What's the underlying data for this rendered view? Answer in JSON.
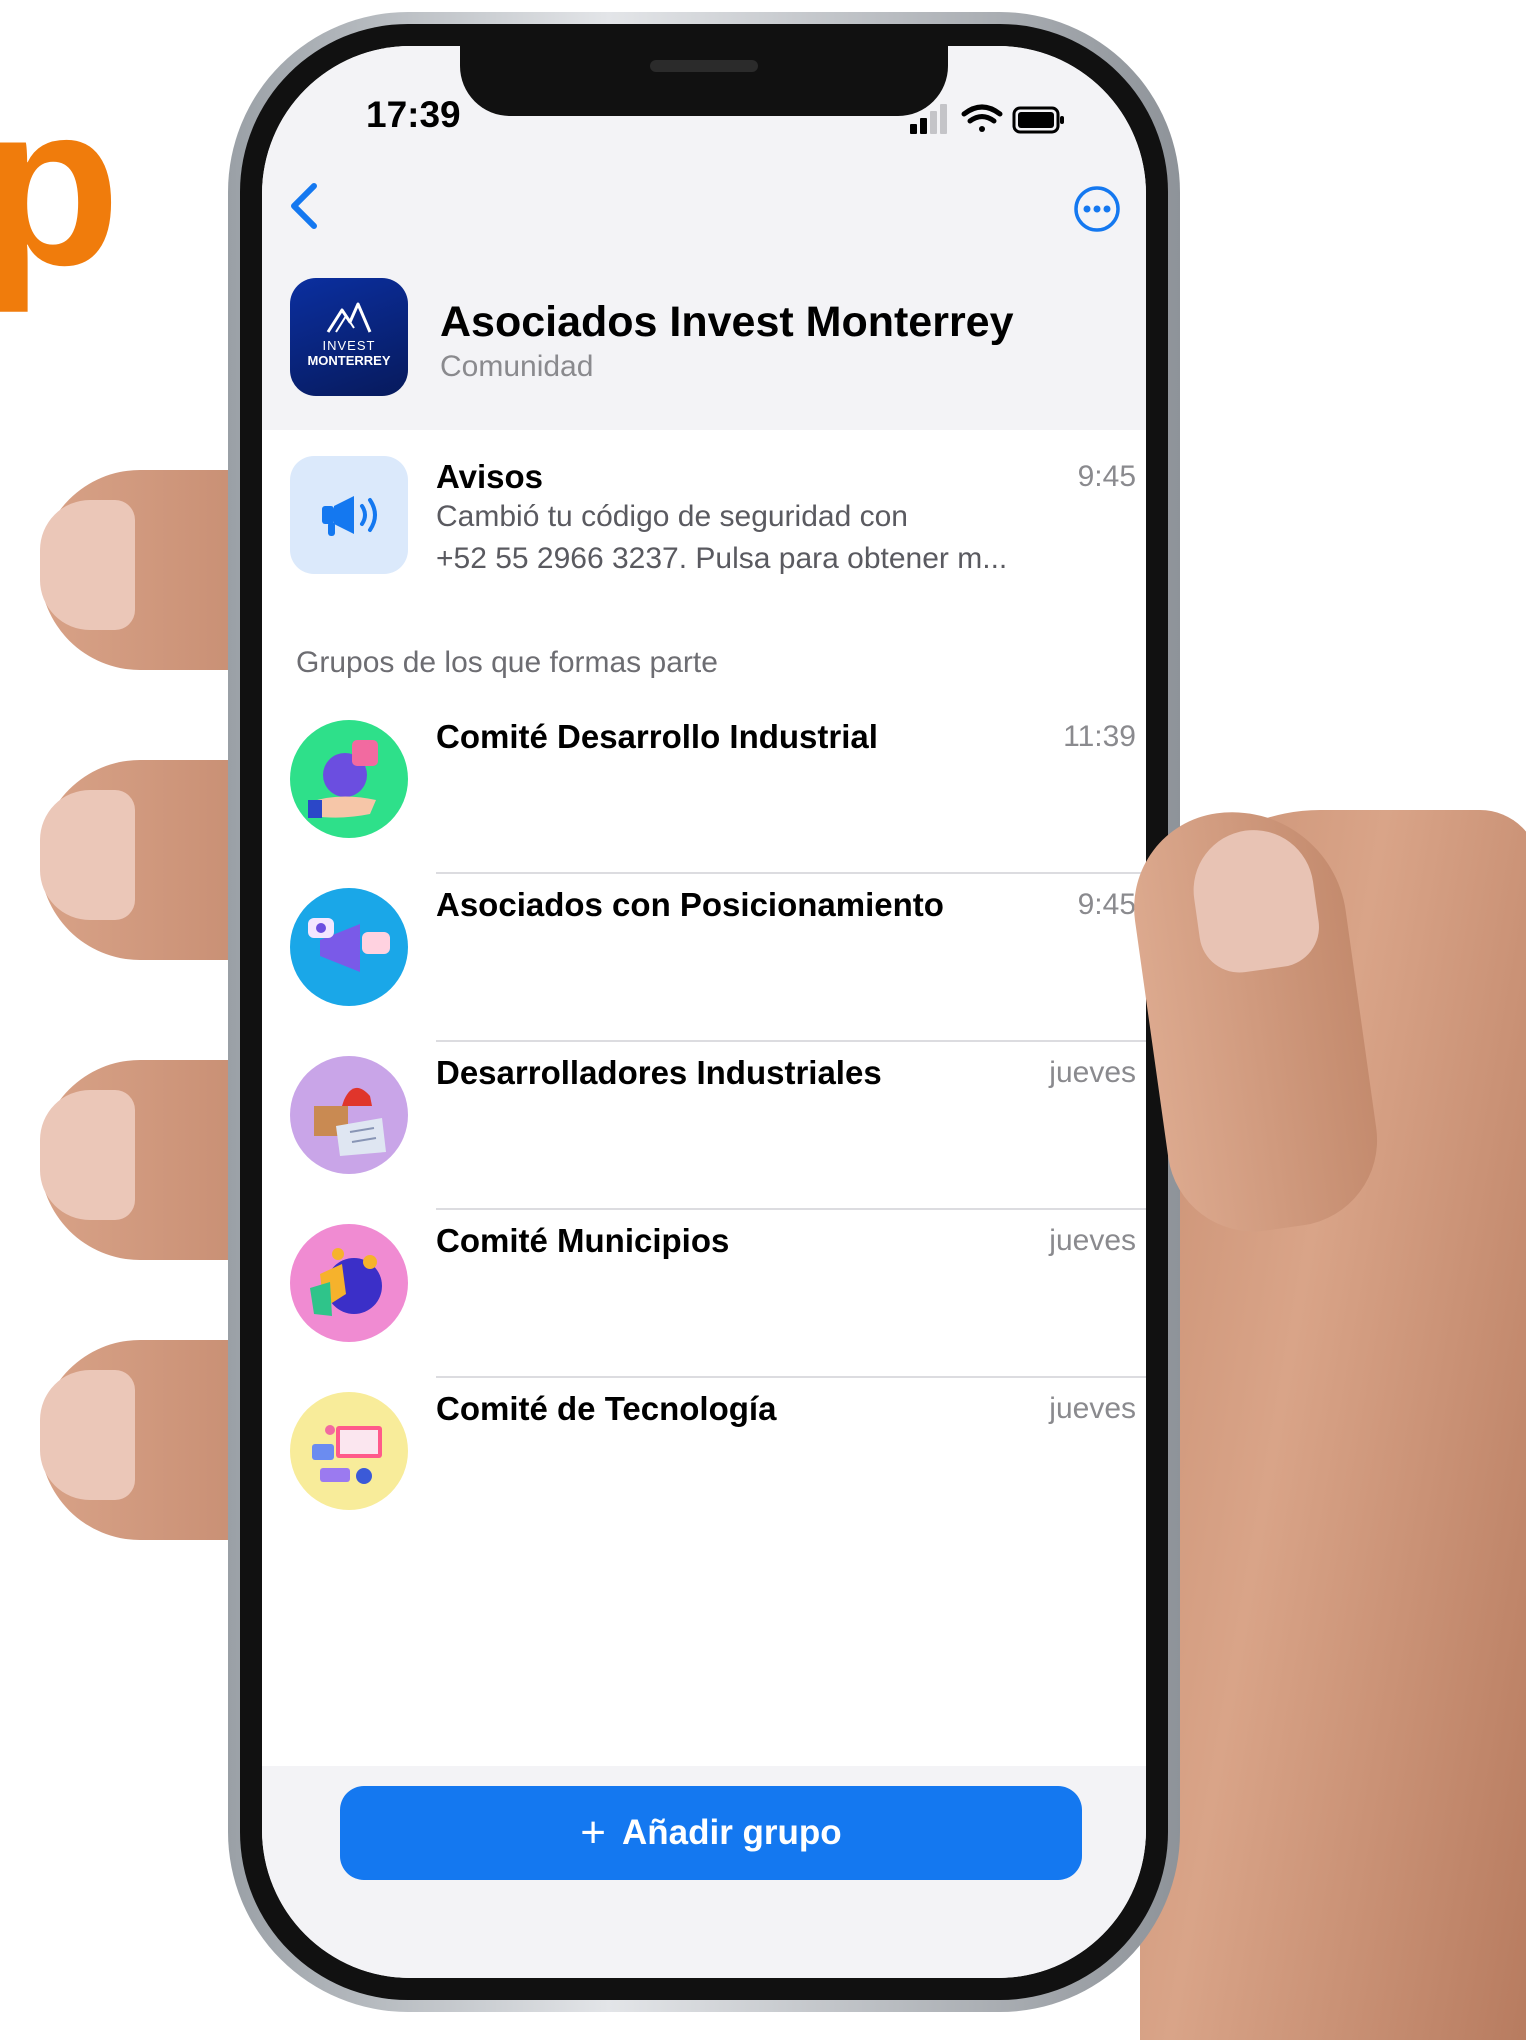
{
  "background": {
    "word": "p",
    "word_color": "#f07c0c"
  },
  "status_bar": {
    "time": "17:39"
  },
  "nav": {
    "back_icon": "chevron-left-icon",
    "more_icon": "ellipsis-circle-icon",
    "accent": "#1478f0"
  },
  "community": {
    "title": "Asociados Invest Monterrey",
    "subtitle": "Comunidad",
    "logo_line1": "INVEST",
    "logo_line2": "MONTERREY"
  },
  "announcements": {
    "title": "Avisos",
    "time": "9:45",
    "line1": "Cambió tu código de seguridad con",
    "line2": "+52 55 2966 3237. Pulsa para obtener m...",
    "icon": "megaphone-icon"
  },
  "groups_header": "Grupos de los que formas parte",
  "groups": [
    {
      "name": "Comité Desarrollo Industrial",
      "time": "11:39",
      "color": "#2ee08a"
    },
    {
      "name": "Asociados con Posicionamiento",
      "time": "9:45",
      "color": "#1aa7e8"
    },
    {
      "name": "Desarrolladores Industriales",
      "time": "jueves",
      "color": "#c9a5e8"
    },
    {
      "name": "Comité Municipios",
      "time": "jueves",
      "color": "#f08bd2"
    },
    {
      "name": "Comité de Tecnología",
      "time": "jueves",
      "color": "#f8ec9a"
    }
  ],
  "add_button": {
    "plus": "+",
    "label": "Añadir grupo"
  }
}
